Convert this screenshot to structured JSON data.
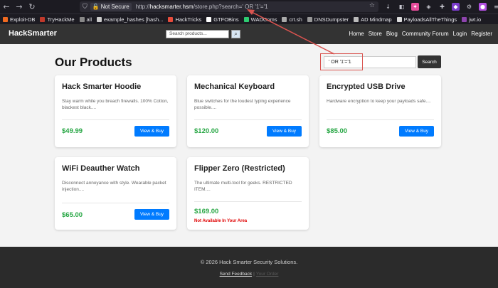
{
  "browser": {
    "nav_back": "←",
    "nav_forward": "→",
    "nav_reload": "↻",
    "shield": "⛉",
    "not_secure_label": "Not Secure",
    "url_prefix": "http://",
    "url_host": "hacksmarter.hsm",
    "url_path": "/store.php?search=' OR '1'='1",
    "bookmarks": [
      {
        "label": "Exploit-DB",
        "color": "#f06a20"
      },
      {
        "label": "TryHackMe",
        "color": "#c0392b"
      },
      {
        "label": "all",
        "color": "#888888"
      },
      {
        "label": "example_hashes [hash...",
        "color": "#cccccc"
      },
      {
        "label": "HackTricks",
        "color": "#e74c3c"
      },
      {
        "label": "GTFOBins",
        "color": "#ffffff"
      },
      {
        "label": "WADComs",
        "color": "#2ecc71"
      },
      {
        "label": "crt.sh",
        "color": "#aaaaaa"
      },
      {
        "label": "DNSDumpster",
        "color": "#999999"
      },
      {
        "label": "AD Mindmap",
        "color": "#bbbbbb"
      },
      {
        "label": "PayloadsAllTheThings",
        "color": "#dddddd"
      },
      {
        "label": "jwt.io",
        "color": "#8e44ad"
      }
    ]
  },
  "site": {
    "brand": "HackSmarter",
    "nav_search_placeholder": "Search products...",
    "nav_search_icon": "⌕",
    "nav_links": [
      "Home",
      "Store",
      "Blog",
      "Community Forum",
      "Login",
      "Register"
    ]
  },
  "main": {
    "heading": "Our Products",
    "search_value": "' OR '1'='1",
    "search_button": "Search"
  },
  "products": [
    {
      "title": "Hack Smarter Hoodie",
      "desc": "Stay warm while you breach firewalls. 100% Cotton, blackest black....",
      "price": "$49.99",
      "button": "View & Buy"
    },
    {
      "title": "Mechanical Keyboard",
      "desc": "Blue switches for the loudest typing experience possible....",
      "price": "$120.00",
      "button": "View & Buy"
    },
    {
      "title": "Encrypted USB Drive",
      "desc": "Hardware encryption to keep your payloads safe....",
      "price": "$85.00",
      "button": "View & Buy"
    },
    {
      "title": "WiFi Deauther Watch",
      "desc": "Disconnect annoyance with style. Wearable packet injection....",
      "price": "$65.00",
      "button": "View & Buy"
    },
    {
      "title": "Flipper Zero (Restricted)",
      "desc": "The ultimate multi-tool for geeks. RESTRICTED ITEM....",
      "price": "$169.00",
      "status": "Not Available In Your Area"
    }
  ],
  "footer": {
    "copyright": "© 2026 Hack Smarter Security Solutions.",
    "link_feedback": "Send Feedback",
    "link_other": "Your Order"
  },
  "colors": {
    "price_green": "#28a745",
    "button_blue": "#007bff",
    "annotation_red": "#d9534f",
    "navbar": "#333333"
  }
}
